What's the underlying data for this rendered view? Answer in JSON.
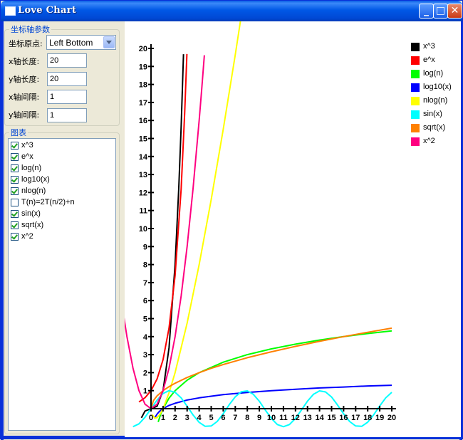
{
  "window": {
    "title": "Love Chart",
    "minimize_glyph": "_",
    "maximize_glyph": "□",
    "close_glyph": "✕"
  },
  "axis_params": {
    "group_title": "坐标轴参数",
    "origin_label": "坐标原点:",
    "origin_value": "Left Bottom",
    "x_length_label": "x轴长度:",
    "x_length_value": "20",
    "y_length_label": "y轴长度:",
    "y_length_value": "20",
    "x_step_label": "x轴间隔:",
    "x_step_value": "1",
    "y_step_label": "y轴间隔:",
    "y_step_value": "1"
  },
  "charts_panel": {
    "group_title": "图表",
    "items": [
      {
        "label": "x^3",
        "checked": true
      },
      {
        "label": "e^x",
        "checked": true
      },
      {
        "label": "log(n)",
        "checked": true
      },
      {
        "label": "log10(x)",
        "checked": true
      },
      {
        "label": "nlog(n)",
        "checked": true
      },
      {
        "label": "T(n)=2T(n/2)+n",
        "checked": false
      },
      {
        "label": "sin(x)",
        "checked": true
      },
      {
        "label": "sqrt(x)",
        "checked": true
      },
      {
        "label": "x^2",
        "checked": true
      }
    ]
  },
  "chart_data": {
    "type": "line",
    "xlim": [
      0,
      20
    ],
    "ylim": [
      0,
      20
    ],
    "x_ticks": [
      "0",
      "1",
      "2",
      "3",
      "4",
      "5",
      "6",
      "7",
      "8",
      "9",
      "10",
      "11",
      "12",
      "13",
      "14",
      "15",
      "16",
      "17",
      "18",
      "19",
      "20"
    ],
    "y_ticks": [
      "1",
      "2",
      "3",
      "4",
      "5",
      "6",
      "7",
      "8",
      "9",
      "10",
      "11",
      "12",
      "13",
      "14",
      "15",
      "16",
      "17",
      "18",
      "19",
      "20"
    ],
    "legend_position": "top-right",
    "series": [
      {
        "name": "x^3",
        "color": "#000000",
        "x": [
          -0.8,
          -0.5,
          0,
          0.5,
          1,
          1.5,
          2,
          2.3,
          2.5,
          2.6,
          2.7
        ],
        "y": [
          -0.51,
          -0.13,
          0,
          0.13,
          1,
          3.38,
          8,
          12.17,
          15.63,
          17.58,
          19.68
        ]
      },
      {
        "name": "e^x",
        "color": "#ff0000",
        "x": [
          -1,
          -0.5,
          0,
          0.5,
          1,
          1.5,
          2,
          2.5,
          2.8,
          2.98
        ],
        "y": [
          0.37,
          0.61,
          1,
          1.65,
          2.72,
          4.48,
          7.39,
          12.18,
          16.44,
          19.69
        ]
      },
      {
        "name": "log(n)",
        "color": "#00ff00",
        "x": [
          0.6,
          0.8,
          1,
          1.5,
          2,
          3,
          4,
          6,
          8,
          10,
          12,
          14,
          16,
          18,
          20
        ],
        "y": [
          -0.74,
          -0.32,
          0,
          0.58,
          1,
          1.58,
          2,
          2.58,
          3,
          3.32,
          3.58,
          3.81,
          4,
          4.17,
          4.32
        ]
      },
      {
        "name": "log10(x)",
        "color": "#0000ff",
        "x": [
          0.3,
          0.5,
          0.7,
          1,
          1.5,
          2,
          3,
          4,
          6,
          8,
          10,
          12,
          14,
          16,
          18,
          20
        ],
        "y": [
          -0.52,
          -0.3,
          -0.15,
          0,
          0.18,
          0.3,
          0.48,
          0.6,
          0.78,
          0.9,
          1,
          1.08,
          1.15,
          1.2,
          1.26,
          1.3
        ]
      },
      {
        "name": "nlog(n)",
        "color": "#ffff00",
        "x": [
          0.1,
          0.3,
          0.5,
          0.75,
          1,
          1.5,
          2,
          3,
          4,
          5,
          6,
          7,
          8,
          9
        ],
        "y": [
          -0.33,
          -0.52,
          -0.5,
          -0.31,
          0,
          0.88,
          2,
          4.75,
          8,
          11.61,
          15.51,
          19.65,
          24,
          28.5
        ]
      },
      {
        "name": "sin(x)",
        "color": "#00ffff",
        "x": [
          -1.5,
          -1,
          -0.5,
          0,
          0.5,
          1,
          1.5,
          2,
          2.5,
          3,
          3.5,
          4,
          4.5,
          5,
          5.5,
          6,
          6.5,
          7,
          7.5,
          8,
          8.5,
          9,
          9.5,
          10,
          10.5,
          11,
          11.5,
          12,
          12.5,
          13,
          13.5,
          14,
          14.5,
          15,
          15.5,
          16,
          16.5,
          17,
          17.5,
          18,
          18.5,
          19,
          19.5,
          20
        ],
        "y": [
          -1.0,
          -0.84,
          -0.48,
          0,
          0.48,
          0.84,
          1.0,
          0.91,
          0.6,
          0.14,
          -0.35,
          -0.76,
          -0.98,
          -0.96,
          -0.71,
          -0.28,
          0.22,
          0.66,
          0.94,
          0.99,
          0.8,
          0.41,
          -0.08,
          -0.54,
          -0.88,
          -1.0,
          -0.88,
          -0.54,
          -0.07,
          0.42,
          0.8,
          0.99,
          0.93,
          0.65,
          0.2,
          -0.29,
          -0.71,
          -0.96,
          -0.98,
          -0.75,
          -0.34,
          0.15,
          0.6,
          0.91
        ]
      },
      {
        "name": "sqrt(x)",
        "color": "#ff8000",
        "x": [
          0,
          0.2,
          0.5,
          1,
          1.5,
          2,
          3,
          4,
          5,
          6,
          8,
          10,
          12,
          14,
          16,
          18,
          20
        ],
        "y": [
          0,
          0.45,
          0.71,
          1,
          1.22,
          1.41,
          1.73,
          2,
          2.24,
          2.45,
          2.83,
          3.16,
          3.46,
          3.74,
          4,
          4.24,
          4.47
        ]
      },
      {
        "name": "x^2",
        "color": "#ff0080",
        "x": [
          -2.3,
          -2,
          -1.5,
          -1,
          -0.5,
          0,
          0.5,
          1,
          1.5,
          2,
          2.5,
          3,
          3.5,
          4,
          4.2,
          4.43
        ],
        "y": [
          5.29,
          4,
          2.25,
          1,
          0.25,
          0,
          0.25,
          1,
          2.25,
          4,
          6.25,
          9,
          12.25,
          16,
          17.64,
          19.62
        ]
      }
    ]
  }
}
